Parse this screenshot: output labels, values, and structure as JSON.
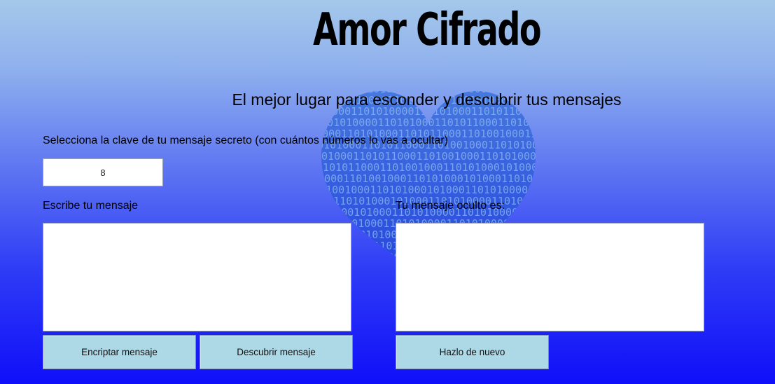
{
  "header": {
    "title": "Amor Cifrado",
    "subtitle": "El mejor lugar para esconder y descubrir tus mensajes"
  },
  "key": {
    "label": "Selecciona la clave de tu mensaje secreto (con cuántos números lo vas a ocultar)",
    "value": "8"
  },
  "input_message": {
    "label": "Escribe tu mensaje",
    "value": ""
  },
  "output_message": {
    "label": "Tu mensaje oculto es:",
    "value": ""
  },
  "buttons": {
    "encrypt": "Encriptar mensaje",
    "decrypt": "Descubrir mensaje",
    "reset": "Hazlo de nuevo"
  },
  "background_image": {
    "icon": "binary-heart-icon",
    "binary_text": "0101000110101000011010100001101010001101011000110100100011010100"
  },
  "colors": {
    "background_top": "#a4c8ea",
    "background_bottom": "#0f0ff9",
    "button_fill": "#add8e6",
    "heart": "#2c5fd8"
  }
}
